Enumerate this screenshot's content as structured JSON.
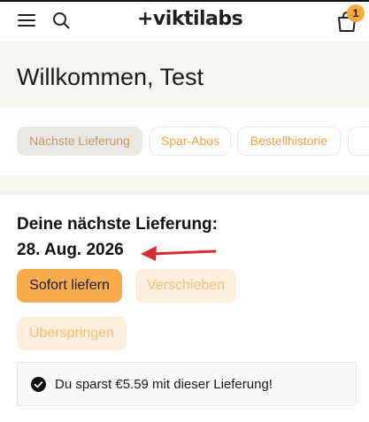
{
  "header": {
    "logo_text": "+viktilabs",
    "cart_count": "1",
    "accent_color": "#f7a93a"
  },
  "welcome": {
    "title": "Willkommen, Test"
  },
  "tabs": [
    {
      "label": "Nächste Lieferung",
      "active": true
    },
    {
      "label": "Spar-Abos",
      "active": false
    },
    {
      "label": "Bestellhistorie",
      "active": false
    },
    {
      "label": "",
      "active": false
    }
  ],
  "delivery": {
    "title": "Deine nächste Lieferung:",
    "date": "28. Aug. 2026",
    "annotation_arrow_color": "#d32f2f"
  },
  "actions": {
    "deliver_now": "Sofort liefern",
    "postpone": "Verschieben",
    "skip": "Überspringen"
  },
  "savings": {
    "message": "Du sparst €5.59 mit dieser Lieferung!",
    "icon": "check-circle-icon"
  }
}
